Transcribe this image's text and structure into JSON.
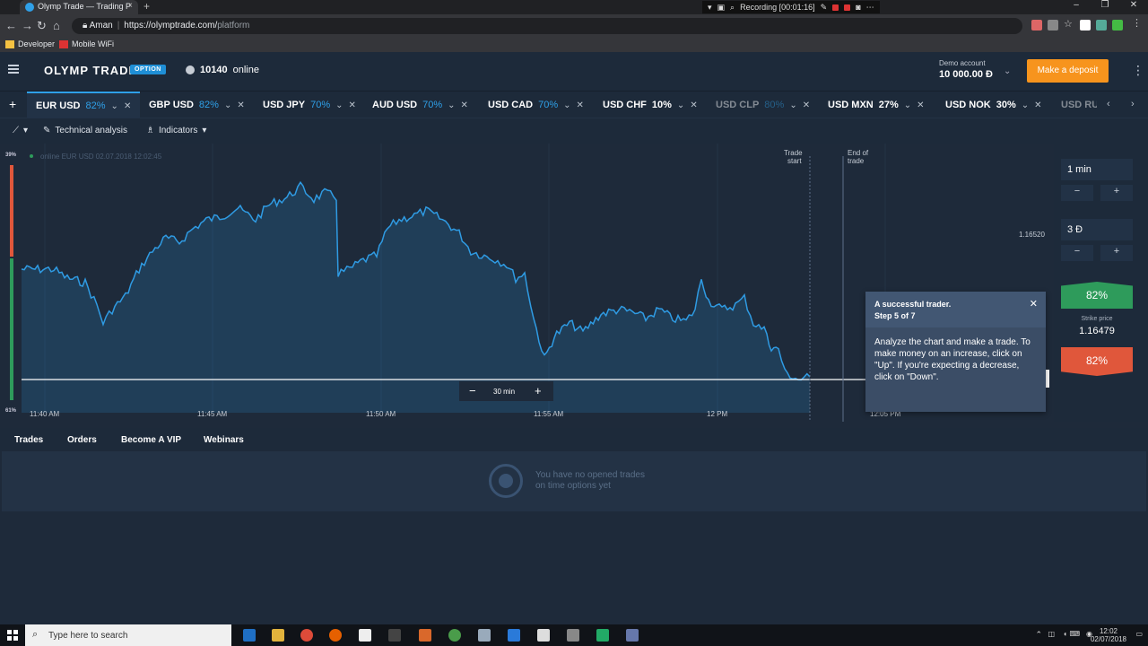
{
  "browser": {
    "tab_title": "Olymp Trade — Trading P",
    "url_prefix": "Aman",
    "url": "https://olymptrade.com/platform",
    "url_host": "https://olymptrade.com/",
    "url_path": "platform",
    "recording": "Recording [00:01:16]",
    "bookmarks": [
      "Developer",
      "Mobile WiFi"
    ]
  },
  "header": {
    "logo": "OLYMP TRADE",
    "logo_badge": "OPTION",
    "online_count": "10140",
    "online_label": "online",
    "account_label": "Demo account",
    "account_balance": "10 000.00 Đ",
    "deposit_label": "Make a deposit"
  },
  "assets": [
    {
      "name": "EUR USD",
      "pct": "82%",
      "active": true
    },
    {
      "name": "GBP USD",
      "pct": "82%"
    },
    {
      "name": "USD JPY",
      "pct": "70%"
    },
    {
      "name": "AUD USD",
      "pct": "70%"
    },
    {
      "name": "USD CAD",
      "pct": "70%"
    },
    {
      "name": "USD CHF",
      "pct": "10%"
    },
    {
      "name": "USD CLP",
      "pct": "80%"
    },
    {
      "name": "USD MXN",
      "pct": "27%"
    },
    {
      "name": "USD NOK",
      "pct": "30%"
    },
    {
      "name": "USD RU",
      "pct": ""
    }
  ],
  "toolbar": {
    "technical_analysis": "Technical analysis",
    "indicators": "Indicators"
  },
  "chart": {
    "legend": "online EUR USD 02.07.2018 12:02:45",
    "price_label": "1.16520",
    "trade_start": [
      "Trade",
      "start"
    ],
    "end_of_trade": [
      "End of",
      "trade"
    ],
    "times": [
      "11:40 AM",
      "11:45 AM",
      "11:50 AM",
      "11:55 AM",
      "12 PM",
      "12:05 PM"
    ],
    "zoom_label": "30 min",
    "side_top": "39%",
    "side_bottom": "61%",
    "colors": {
      "line": "#2f9be3",
      "up": "#2e9b5b",
      "down": "#e0573b"
    }
  },
  "panel": {
    "time": "1 min",
    "amount": "3 Đ",
    "up_pct": "82%",
    "strike_label": "Strike price",
    "strike_value": "1.16479",
    "down_pct": "82%"
  },
  "tour": {
    "title": "A successful trader.",
    "step": "Step 5 of 7",
    "body": "Analyze the chart and make a trade. To make money on an increase, click on \"Up\". If you're expecting a decrease, click on \"Down\"."
  },
  "bottom": {
    "tabs": [
      "Trades",
      "Orders",
      "Become A VIP",
      "Webinars"
    ],
    "empty_line1": "You have no opened trades",
    "empty_line2": "on time options yet"
  },
  "taskbar": {
    "search_placeholder": "Type here to search",
    "time": "12:02",
    "date": "02/07/2018"
  }
}
